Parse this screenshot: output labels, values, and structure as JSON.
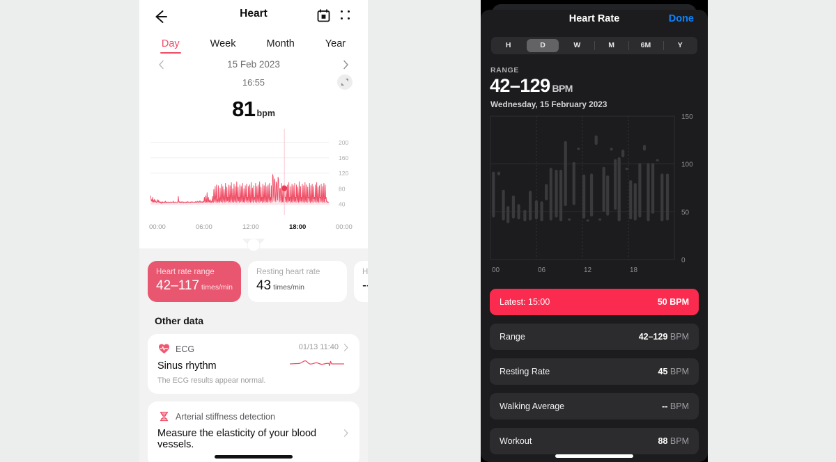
{
  "left_phone": {
    "header": {
      "back_icon": "back-arrow-icon",
      "title": "Heart",
      "calendar_icon": "calendar-icon",
      "menu_icon": "grid-dots-icon"
    },
    "tabs": [
      {
        "label": "Day",
        "active": true
      },
      {
        "label": "Week",
        "active": false
      },
      {
        "label": "Month",
        "active": false
      },
      {
        "label": "Year",
        "active": false
      }
    ],
    "date_nav": {
      "prev_icon": "chevron-left-icon",
      "date": "15 Feb 2023",
      "next_icon": "chevron-right-icon"
    },
    "time": "16:55",
    "expand_icon": "expand-arrows-icon",
    "reading": {
      "value": "81",
      "unit": "bpm"
    },
    "chart": {
      "y_ticks": [
        "200",
        "160",
        "120",
        "80",
        "40"
      ],
      "x_ticks": [
        "00:00",
        "06:00",
        "12:00",
        "18:00",
        "00:00"
      ],
      "highlight_x_label": "18:00",
      "line_color": "#ef4a63",
      "fill_color": "#fbe0e5"
    },
    "cards": [
      {
        "label": "Heart rate range",
        "value": "42–117",
        "unit": "times/min",
        "accent": true
      },
      {
        "label": "Resting heart rate",
        "value": "43",
        "unit": "times/min",
        "accent": false
      },
      {
        "label": "Hig",
        "value": "--",
        "unit": "",
        "accent": false
      }
    ],
    "other_data_title": "Other data",
    "ecg": {
      "icon": "heart-pulse-icon",
      "name": "ECG",
      "timestamp": "01/13 11:40",
      "result": "Sinus rhythm",
      "description": "The ECG results appear normal.",
      "chevron_icon": "chevron-right-icon",
      "waveform_icon": "ecg-waveform-icon"
    },
    "arterial": {
      "icon": "arterial-stiffness-icon",
      "name": "Arterial stiffness detection",
      "description": "Measure the elasticity of your blood vessels.",
      "chevron_icon": "chevron-right-icon"
    },
    "home_indicator": "home-indicator"
  },
  "right_phone": {
    "title": "Heart Rate",
    "done_label": "Done",
    "segments": [
      {
        "label": "H",
        "selected": false
      },
      {
        "label": "D",
        "selected": true
      },
      {
        "label": "W",
        "selected": false
      },
      {
        "label": "M",
        "selected": false
      },
      {
        "label": "6M",
        "selected": false
      },
      {
        "label": "Y",
        "selected": false
      }
    ],
    "range_label": "RANGE",
    "range_value": "42–129",
    "range_unit": "BPM",
    "range_date": "Wednesday, 15 February 2023",
    "rows": [
      {
        "label": "Latest: 15:00",
        "value": "50",
        "unit": "BPM",
        "highlight": true
      },
      {
        "label": "Range",
        "value": "42–129",
        "unit": "BPM",
        "highlight": false
      },
      {
        "label": "Resting Rate",
        "value": "45",
        "unit": "BPM",
        "highlight": false
      },
      {
        "label": "Walking Average",
        "value": "--",
        "unit": "BPM",
        "highlight": false
      },
      {
        "label": "Workout",
        "value": "88",
        "unit": "BPM",
        "highlight": false
      }
    ],
    "accent_color": "#fa2b4e",
    "link_color": "#0a84ff",
    "home_indicator": "home-indicator"
  },
  "chart_data": [
    {
      "type": "line",
      "id": "left-heart-rate-day",
      "title": "Heart rate — 15 Feb 2023",
      "xlabel": "",
      "ylabel": "bpm",
      "ylim": [
        30,
        210
      ],
      "yticks": [
        40,
        80,
        120,
        160,
        200
      ],
      "xticks": [
        "00:00",
        "06:00",
        "12:00",
        "18:00",
        "00:00"
      ],
      "grid": true,
      "marker": {
        "x_label": "18:00",
        "value": 81
      },
      "values": [
        62,
        55,
        48,
        52,
        47,
        58,
        44,
        50,
        46,
        53,
        45,
        49,
        47,
        44,
        46,
        52,
        48,
        45,
        50,
        44,
        47,
        45,
        43,
        46,
        42,
        44,
        47,
        43,
        45,
        44,
        46,
        43,
        45,
        48,
        44,
        46,
        43,
        45,
        44,
        46,
        44,
        43,
        45,
        44,
        46,
        45,
        43,
        44,
        46,
        45,
        44,
        48,
        44,
        45,
        43,
        44,
        46,
        45,
        44,
        43,
        45,
        48,
        60,
        46,
        44,
        47,
        45,
        43,
        46,
        44,
        47,
        45,
        44,
        46,
        43,
        45,
        44,
        46,
        45,
        43,
        46,
        44,
        45,
        47,
        44,
        46,
        45,
        44,
        43,
        46,
        44,
        45,
        47,
        44,
        46,
        45,
        44,
        46,
        45,
        44,
        47,
        45,
        46,
        44,
        48,
        45,
        47,
        44,
        46,
        45,
        49,
        46,
        44,
        47,
        45,
        46,
        44,
        48,
        45,
        47,
        58,
        46,
        44,
        62,
        48,
        45,
        70,
        47,
        44,
        58,
        46,
        50,
        44,
        52,
        46,
        44,
        48,
        45,
        60,
        47,
        44,
        78,
        52,
        46,
        86,
        54,
        44,
        90,
        48,
        52,
        44,
        88,
        46,
        56,
        44,
        82,
        50,
        46,
        92,
        48,
        44,
        86,
        54,
        46,
        78,
        50,
        44,
        94,
        52,
        46,
        84,
        48,
        58,
        44,
        90,
        52,
        46,
        88,
        50,
        44,
        96,
        54,
        46,
        80,
        48,
        44,
        92,
        52,
        46,
        86,
        50,
        44,
        98,
        56,
        46,
        84,
        48,
        58,
        44,
        90,
        54,
        46,
        86,
        50,
        44,
        94,
        52,
        46,
        80,
        48,
        44,
        88,
        56,
        46,
        92,
        50,
        58,
        44,
        86,
        52,
        46,
        90,
        48,
        44,
        96,
        54,
        46,
        82,
        50,
        44,
        88,
        52,
        58,
        46,
        94,
        48,
        44,
        86,
        56,
        46,
        90,
        52,
        44,
        98,
        50,
        46,
        84,
        48,
        58,
        44,
        92,
        54,
        46,
        88,
        50,
        44,
        96,
        52,
        46,
        86,
        48,
        44,
        90,
        56,
        46,
        94,
        50,
        58,
        44,
        88,
        52,
        46,
        117,
        112,
        60,
        48,
        106,
        100,
        55,
        46,
        98,
        92,
        62,
        50,
        110,
        104,
        58,
        46,
        81,
        81,
        50,
        44,
        94,
        52,
        46,
        88,
        48,
        44,
        92,
        56,
        58,
        46,
        84,
        50,
        44,
        90,
        52,
        46,
        96,
        48,
        58,
        44,
        86,
        54,
        46,
        92,
        50,
        44,
        88,
        52,
        46,
        94,
        48,
        58,
        44,
        90,
        56,
        46,
        84,
        50,
        44,
        98,
        52,
        46,
        86,
        48,
        58,
        44,
        92,
        54,
        46,
        88,
        50,
        44,
        96,
        52,
        46,
        90,
        48,
        44,
        84,
        56,
        58,
        46,
        94,
        50,
        44,
        88,
        52,
        46,
        92,
        48,
        44,
        86,
        54,
        58,
        46,
        90,
        50,
        44,
        96,
        52,
        46,
        84,
        48,
        44,
        88,
        56,
        58,
        46,
        92,
        50,
        44,
        86,
        52,
        46,
        94,
        48,
        44,
        90,
        54,
        58,
        46,
        48,
        44,
        46,
        45,
        44
      ]
    },
    {
      "type": "bar",
      "id": "right-heart-rate-ranges",
      "title": "Heart Rate range bars",
      "xlabel": "",
      "ylabel": "BPM",
      "ylim": [
        0,
        150
      ],
      "yticks": [
        0,
        50,
        100,
        150
      ],
      "xticks": [
        "00",
        "06",
        "12",
        "18"
      ],
      "grid": true,
      "bar_color": "#3a3a3c",
      "note": "each bar is a min-max range for a time slot across the day",
      "bars": [
        {
          "t": 0.2,
          "min": 44,
          "max": 92
        },
        {
          "t": 0.9,
          "min": 88,
          "max": 92
        },
        {
          "t": 1.5,
          "min": 41,
          "max": 73
        },
        {
          "t": 2.1,
          "min": 38,
          "max": 56
        },
        {
          "t": 2.8,
          "min": 43,
          "max": 67
        },
        {
          "t": 3.5,
          "min": 42,
          "max": 58
        },
        {
          "t": 4.3,
          "min": 40,
          "max": 52
        },
        {
          "t": 5.0,
          "min": 41,
          "max": 72
        },
        {
          "t": 5.8,
          "min": 42,
          "max": 62
        },
        {
          "t": 6.5,
          "min": 40,
          "max": 61
        },
        {
          "t": 7.1,
          "min": 62,
          "max": 79
        },
        {
          "t": 7.7,
          "min": 41,
          "max": 96
        },
        {
          "t": 8.4,
          "min": 44,
          "max": 94
        },
        {
          "t": 9.0,
          "min": 40,
          "max": 94
        },
        {
          "t": 9.6,
          "min": 56,
          "max": 124
        },
        {
          "t": 10.1,
          "min": 41,
          "max": 43
        },
        {
          "t": 10.7,
          "min": 57,
          "max": 102
        },
        {
          "t": 11.3,
          "min": 115,
          "max": 117
        },
        {
          "t": 12.0,
          "min": 43,
          "max": 89
        },
        {
          "t": 12.5,
          "min": 41,
          "max": 42
        },
        {
          "t": 13.0,
          "min": 45,
          "max": 90
        },
        {
          "t": 13.6,
          "min": 120,
          "max": 130
        },
        {
          "t": 14.1,
          "min": 42,
          "max": 43
        },
        {
          "t": 14.6,
          "min": 50,
          "max": 97
        },
        {
          "t": 15.1,
          "min": 46,
          "max": 88
        },
        {
          "t": 15.6,
          "min": 114,
          "max": 117
        },
        {
          "t": 16.1,
          "min": 52,
          "max": 105
        },
        {
          "t": 16.6,
          "min": 40,
          "max": 107
        },
        {
          "t": 17.1,
          "min": 107,
          "max": 115
        },
        {
          "t": 17.6,
          "min": 94,
          "max": 96
        },
        {
          "t": 18.1,
          "min": 42,
          "max": 83
        },
        {
          "t": 18.7,
          "min": 41,
          "max": 80
        },
        {
          "t": 19.3,
          "min": 44,
          "max": 101
        },
        {
          "t": 19.9,
          "min": 114,
          "max": 120
        },
        {
          "t": 20.4,
          "min": 40,
          "max": 101
        },
        {
          "t": 21.0,
          "min": 48,
          "max": 101
        },
        {
          "t": 21.6,
          "min": 103,
          "max": 105
        },
        {
          "t": 22.2,
          "min": 40,
          "max": 90
        },
        {
          "t": 22.9,
          "min": 41,
          "max": 90
        }
      ]
    }
  ]
}
